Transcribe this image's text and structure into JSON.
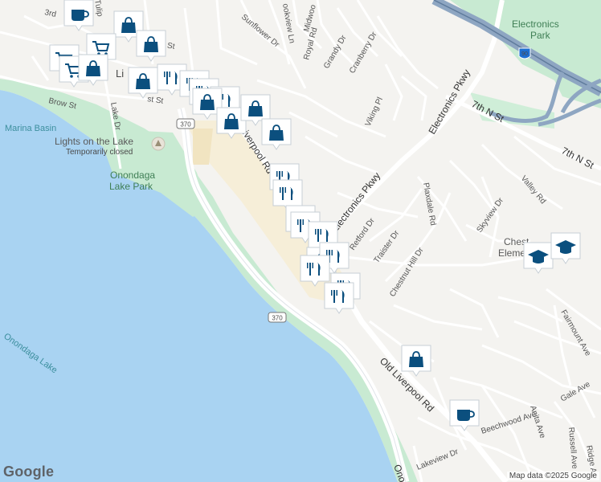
{
  "labels": {
    "brow_st": "Brow St",
    "marina_basin": "Marina Basin",
    "lights_on_the_lake": "Lights on the Lake",
    "temporarily_closed": "Temporarily closed",
    "onondaga_lake_park_1": "Onondaga",
    "onondaga_lake_park_2": "Lake Park",
    "onondaga_lake": "Onondaga Lake",
    "lake_dr": "Lake Dr",
    "old_liverpool_rd_top": "Liverpool Rd",
    "old_liverpool_rd_bottom": "Old Liverpool Rd",
    "old_liverpool_rd_third": "Ono",
    "sunflower_dr": "Sunflower Dr",
    "royal_rd": "Royal Rd",
    "grandy_dr": "Grandy Dr",
    "cranberry_dr": "Cranberry Dr",
    "midwood": "Midwoo",
    "brookview_ln": "ookview Ln",
    "viking_pl": "Viking Pl",
    "electronics_pkwy_1": "Electronics Pkwy",
    "electronics_pkwy_2": "Electronics Pkwy",
    "seventh_n_st_1": "7th N St",
    "seventh_n_st_2": "7th N St",
    "electronics_park_1": "Electronics",
    "electronics_park_2": "Park",
    "interstate_shield": "90",
    "valley_rd": "Valley Rd",
    "skyview_dr": "Skyview Dr",
    "plaxdale_rd": "Plaxdale Rd",
    "traister_dr": "Traister Dr",
    "retford_dr": "Retford Dr",
    "chestnut_hill_dr": "Chestnut Hill Dr",
    "chestnut_school_1": "Chest",
    "chestnut_school_2": "Elementa",
    "fairmount_ave": "Fairmount Ave",
    "gale_ave": "Gale Ave",
    "anita_ave": "Anita Ave",
    "beechwood_ave": "Beechwood Ave",
    "russell_ave": "Russell Ave",
    "ridge_ave": "Ridge Av",
    "lakeview_dr": "Lakeview Dr",
    "third_st": "3rd",
    "tulip_st": "Tulip",
    "st_top": "s St",
    "st_mid": "st St",
    "liverpool_frag": "Li",
    "route_370_a": "370",
    "route_370_b": "370"
  },
  "attribution": "Map data ©2025 Google",
  "logo": "Google",
  "colors": {
    "water": "#a9d3f2",
    "park": "#c8ead2",
    "pin": "#0b4f7e",
    "road": "#ffffff",
    "interstate": "#8ea6c2",
    "commercial": "#f6ecd2"
  },
  "markers": [
    {
      "icon": "coffee-icon"
    },
    {
      "icon": "shopping-bag-icon"
    },
    {
      "icon": "shopping-bag-icon"
    },
    {
      "icon": "shopping-cart-icon"
    },
    {
      "icon": "shopping-cart-icon"
    },
    {
      "icon": "shopping-cart-icon"
    },
    {
      "icon": "shopping-bag-icon"
    },
    {
      "icon": "shopping-bag-icon"
    },
    {
      "icon": "restaurant-icon"
    },
    {
      "icon": "restaurant-icon"
    },
    {
      "icon": "restaurant-icon"
    },
    {
      "icon": "restaurant-icon"
    },
    {
      "icon": "shopping-bag-icon"
    },
    {
      "icon": "shopping-bag-icon"
    },
    {
      "icon": "shopping-bag-icon"
    },
    {
      "icon": "shopping-bag-icon"
    },
    {
      "icon": "restaurant-icon"
    },
    {
      "icon": "restaurant-icon"
    },
    {
      "icon": "restaurant-icon"
    },
    {
      "icon": "restaurant-icon"
    },
    {
      "icon": "restaurant-icon"
    },
    {
      "icon": "shopping-bag-icon"
    },
    {
      "icon": "restaurant-icon"
    },
    {
      "icon": "restaurant-icon"
    },
    {
      "icon": "restaurant-icon"
    },
    {
      "icon": "restaurant-icon"
    },
    {
      "icon": "shopping-bag-icon"
    },
    {
      "icon": "coffee-icon"
    },
    {
      "icon": "school-icon"
    },
    {
      "icon": "school-icon"
    }
  ]
}
